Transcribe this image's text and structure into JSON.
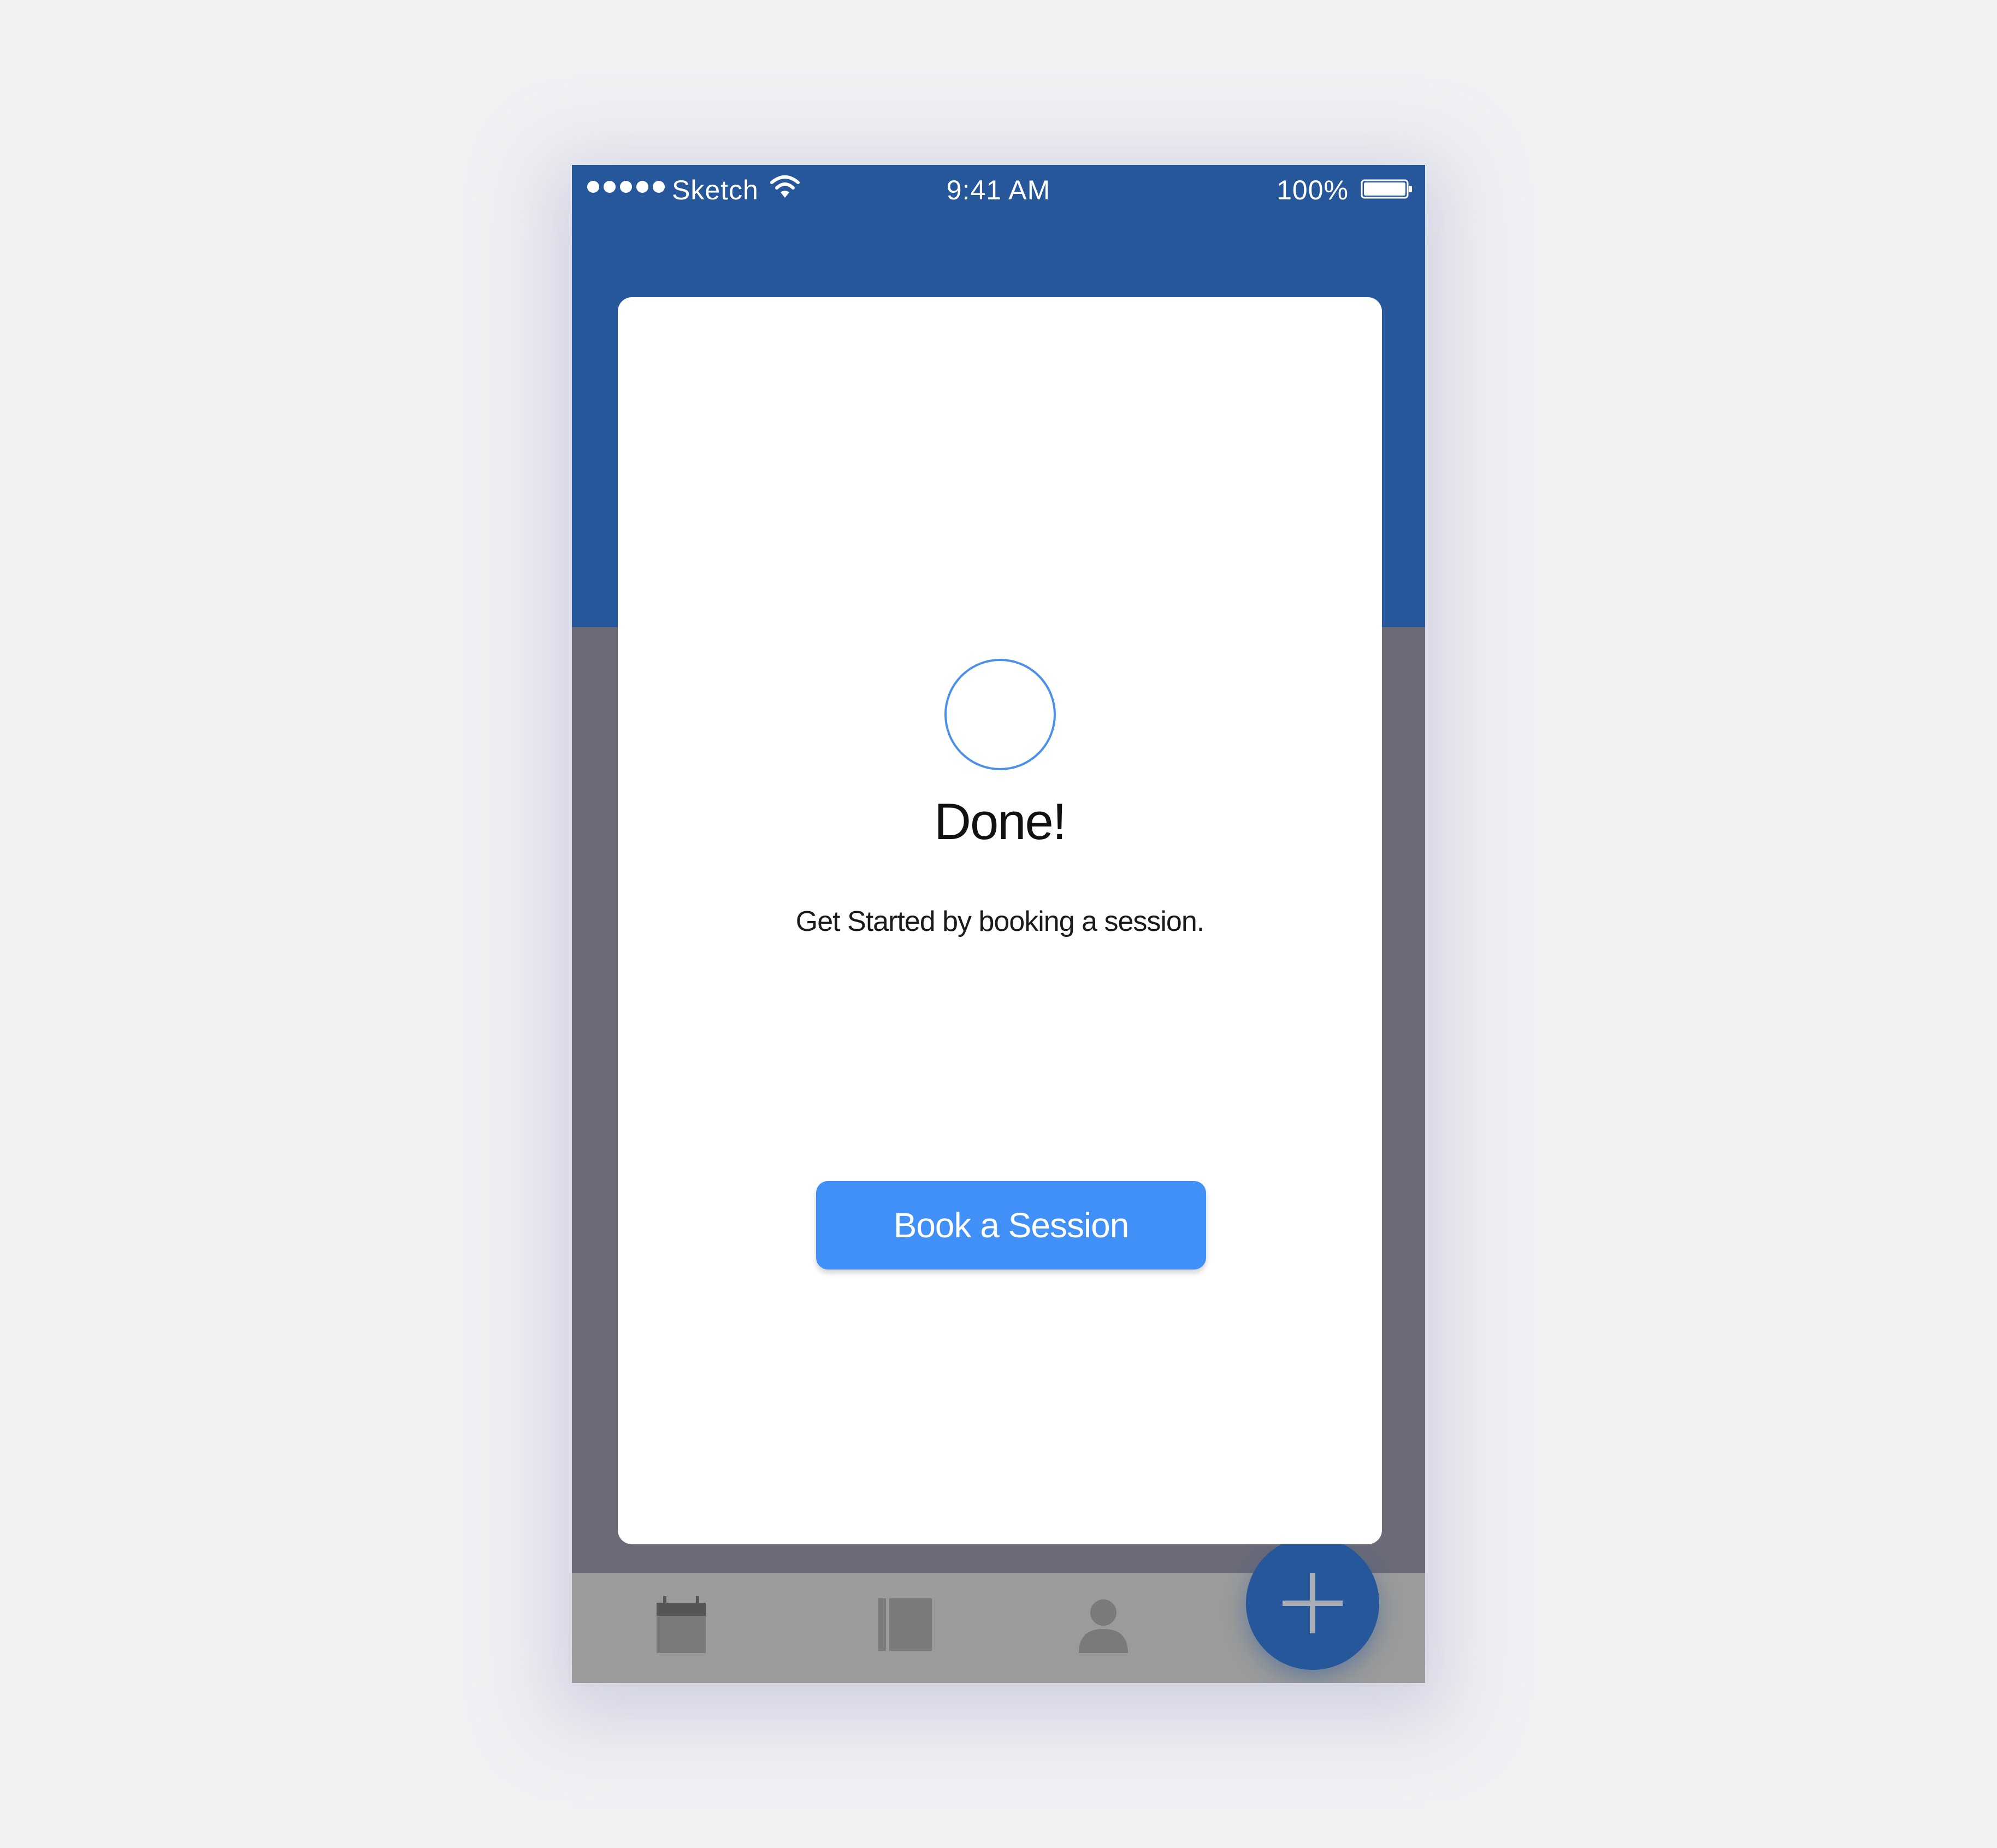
{
  "status_bar": {
    "carrier": "Sketch",
    "time": "9:41 AM",
    "battery_percent": "100%",
    "signal_bars": 5,
    "icons": [
      "signal-dots-icon",
      "wifi-icon",
      "battery-icon"
    ]
  },
  "modal": {
    "status_icon": "success-circle-icon",
    "title": "Done!",
    "message": "Get Started by booking a session.",
    "primary_button": "Book a Session"
  },
  "tab_bar": {
    "items": [
      {
        "icon": "calendar-icon"
      },
      {
        "icon": "book-icon"
      },
      {
        "icon": "profile-icon"
      }
    ],
    "fab_icon": "plus-icon"
  },
  "colors": {
    "header": "#26579a",
    "overlay": "#6b6b78",
    "accent": "#4190f7",
    "circle_stroke": "#4a8fec",
    "tab_bar": "#9b9b9b",
    "background": "#f1f1f4"
  }
}
